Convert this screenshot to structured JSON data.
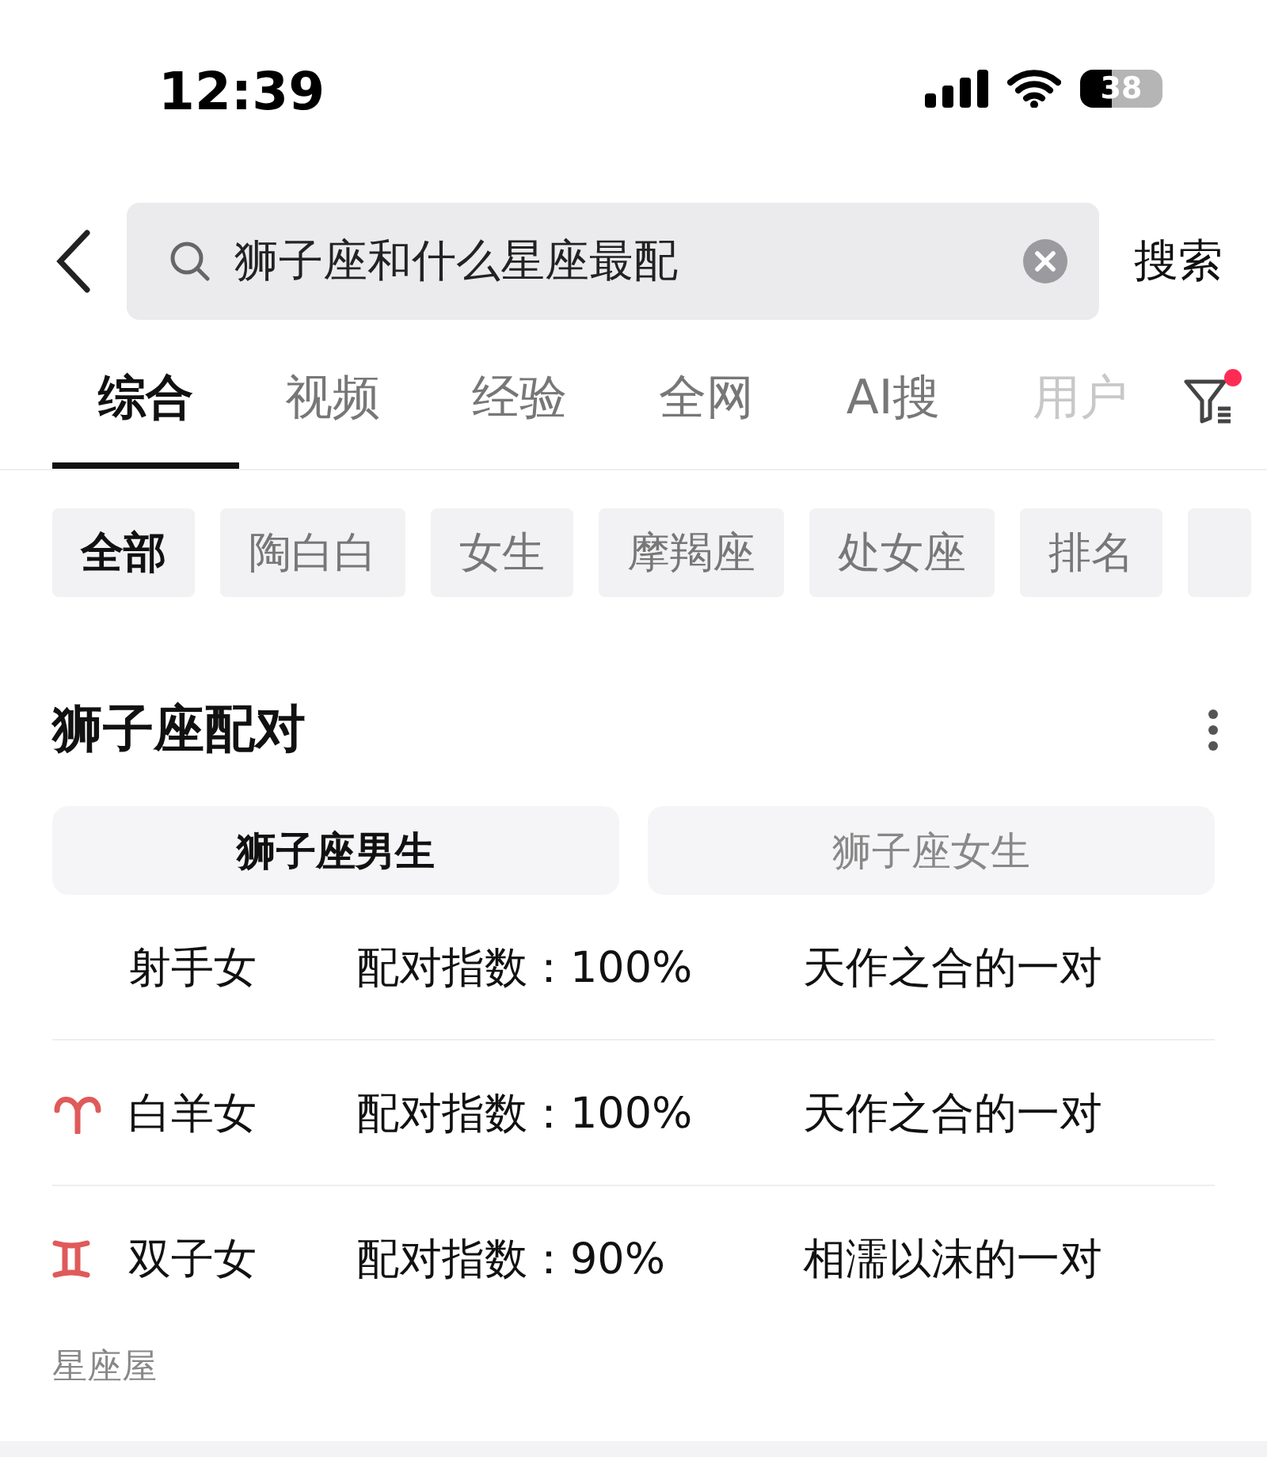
{
  "status_bar": {
    "time": "12:39",
    "battery": "38"
  },
  "search": {
    "value": "狮子座和什么星座最配",
    "button": "搜索"
  },
  "tabs": [
    {
      "label": "综合",
      "selected": true
    },
    {
      "label": "视频",
      "selected": false
    },
    {
      "label": "经验",
      "selected": false
    },
    {
      "label": "全网",
      "selected": false
    },
    {
      "label": "AI搜",
      "selected": false
    },
    {
      "label": "用户",
      "selected": false
    }
  ],
  "filter": {
    "badge": true
  },
  "chips": [
    {
      "label": "全部",
      "selected": true
    },
    {
      "label": "陶白白",
      "selected": false
    },
    {
      "label": "女生",
      "selected": false
    },
    {
      "label": "摩羯座",
      "selected": false
    },
    {
      "label": "处女座",
      "selected": false
    },
    {
      "label": "排名",
      "selected": false
    }
  ],
  "card": {
    "title": "狮子座配对",
    "subtabs": [
      {
        "label": "狮子座男生",
        "selected": true
      },
      {
        "label": "狮子座女生",
        "selected": false
      }
    ],
    "rows": [
      {
        "kind": "plain",
        "sign": "射手女",
        "score": "配对指数：100%",
        "verdict": "天作之合的一对"
      },
      {
        "kind": "aries",
        "sign": "白羊女",
        "score": "配对指数：100%",
        "verdict": "天作之合的一对"
      },
      {
        "kind": "gemini",
        "sign": "双子女",
        "score": "配对指数：90%",
        "verdict": "相濡以沫的一对"
      }
    ],
    "source": "星座屋"
  }
}
